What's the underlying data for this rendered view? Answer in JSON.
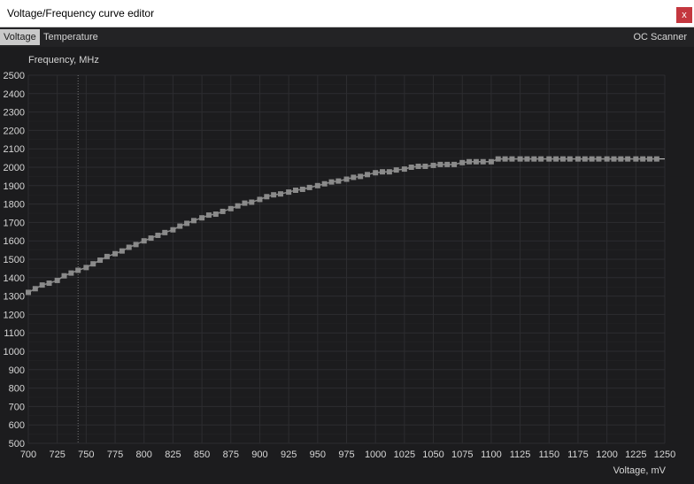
{
  "window": {
    "title": "Voltage/Frequency curve editor",
    "close_label": "x"
  },
  "tabs": {
    "voltage": "Voltage",
    "temperature": "Temperature",
    "oc_scanner": "OC Scanner"
  },
  "colors": {
    "background": "#1c1c1e",
    "grid": "#2d2d30",
    "curve": "#8a8a8a",
    "text": "#d6d6d6",
    "close": "#c4373f"
  },
  "chart_data": {
    "type": "line",
    "ylabel": "Frequency, MHz",
    "xlabel": "Voltage, mV",
    "xlim": [
      700,
      1250
    ],
    "ylim": [
      500,
      2500
    ],
    "grid": true,
    "x_ticks": [
      700,
      725,
      750,
      775,
      800,
      825,
      850,
      875,
      900,
      925,
      950,
      975,
      1000,
      1025,
      1050,
      1075,
      1100,
      1125,
      1150,
      1175,
      1200,
      1225,
      1250
    ],
    "y_ticks": [
      500,
      600,
      700,
      800,
      900,
      1000,
      1100,
      1200,
      1300,
      1400,
      1500,
      1600,
      1700,
      1800,
      1900,
      2000,
      2100,
      2200,
      2300,
      2400,
      2500
    ],
    "cursor_voltage": 743,
    "x": [
      700,
      706,
      712,
      718,
      725,
      731,
      737,
      743,
      750,
      756,
      762,
      768,
      775,
      781,
      787,
      793,
      800,
      806,
      812,
      818,
      825,
      831,
      837,
      843,
      850,
      856,
      862,
      868,
      875,
      881,
      887,
      893,
      900,
      906,
      912,
      918,
      925,
      931,
      937,
      943,
      950,
      956,
      962,
      968,
      975,
      981,
      987,
      993,
      1000,
      1006,
      1012,
      1018,
      1025,
      1031,
      1037,
      1043,
      1050,
      1056,
      1062,
      1068,
      1075,
      1081,
      1087,
      1093,
      1100,
      1106,
      1112,
      1118,
      1125,
      1131,
      1137,
      1143,
      1150,
      1156,
      1162,
      1168,
      1175,
      1181,
      1187,
      1193,
      1200,
      1206,
      1212,
      1218,
      1225,
      1231,
      1237,
      1243
    ],
    "y": [
      1320,
      1340,
      1360,
      1370,
      1385,
      1410,
      1425,
      1440,
      1455,
      1475,
      1495,
      1515,
      1530,
      1545,
      1565,
      1580,
      1600,
      1615,
      1630,
      1645,
      1660,
      1680,
      1695,
      1710,
      1725,
      1740,
      1745,
      1760,
      1775,
      1790,
      1805,
      1810,
      1825,
      1840,
      1850,
      1855,
      1865,
      1875,
      1880,
      1890,
      1900,
      1910,
      1920,
      1925,
      1935,
      1945,
      1950,
      1960,
      1970,
      1975,
      1975,
      1985,
      1990,
      2000,
      2005,
      2005,
      2010,
      2015,
      2015,
      2015,
      2025,
      2030,
      2030,
      2030,
      2030,
      2045,
      2045,
      2045,
      2045,
      2045,
      2045,
      2045,
      2045,
      2045,
      2045,
      2045,
      2045,
      2045,
      2045,
      2045,
      2045,
      2045,
      2045,
      2045,
      2045,
      2045,
      2045,
      2045
    ]
  }
}
